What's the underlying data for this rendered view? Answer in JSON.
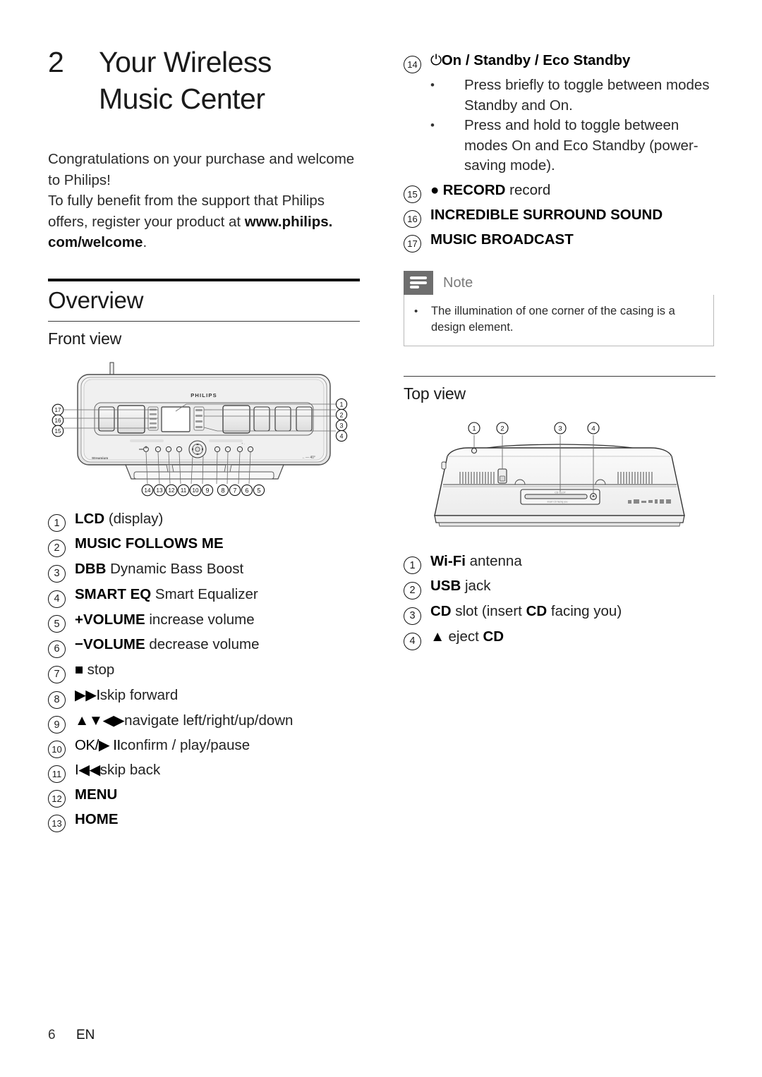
{
  "chapter": {
    "number": "2",
    "title_line1": "Your Wireless",
    "title_line2": "Music Center"
  },
  "intro": {
    "line1": "Congratulations on your purchase and welcome",
    "line2": "to Philips!",
    "line3": "To fully benefit from the support that Philips",
    "line4_pre": "offers, register your product at ",
    "line4_bold": "www.philips.",
    "line5_bold": "com/welcome",
    "line5_post": "."
  },
  "sections": {
    "overview": "Overview",
    "front_view": "Front view",
    "top_view": "Top view"
  },
  "front_legend": [
    {
      "num": "1",
      "glyph": "",
      "bold": "LCD",
      "rest": " (display)"
    },
    {
      "num": "2",
      "glyph": "",
      "bold": "MUSIC FOLLOWS ME",
      "rest": ""
    },
    {
      "num": "3",
      "glyph": "",
      "bold": "DBB",
      "rest": " Dynamic Bass Boost"
    },
    {
      "num": "4",
      "glyph": "",
      "bold": "SMART EQ",
      "rest": " Smart Equalizer"
    },
    {
      "num": "5",
      "glyph": "",
      "bold": "+VOLUME",
      "rest": " increase volume"
    },
    {
      "num": "6",
      "glyph": "",
      "bold": "−VOLUME",
      "rest": " decrease volume"
    },
    {
      "num": "7",
      "glyph": "■",
      "bold": "",
      "rest": " stop"
    },
    {
      "num": "8",
      "glyph": "▶▶I",
      "bold": "",
      "rest": "skip forward"
    },
    {
      "num": "9",
      "glyph": "▲▼◀▶",
      "bold": "",
      "rest": "navigate left/right/up/down"
    },
    {
      "num": "10",
      "glyph": "OK/▶ II",
      "bold": "",
      "rest": "confirm / play/pause"
    },
    {
      "num": "11",
      "glyph": "I◀◀",
      "bold": "",
      "rest": "skip back"
    },
    {
      "num": "12",
      "glyph": "",
      "bold": "MENU",
      "rest": ""
    },
    {
      "num": "13",
      "glyph": "",
      "bold": "HOME",
      "rest": ""
    }
  ],
  "right_legend": [
    {
      "num": "14",
      "glyph": "⏻",
      "bold": "On / Standby / Eco Standby",
      "rest": "",
      "sub": [
        "Press briefly to toggle between modes Standby and On.",
        "Press and hold to toggle between modes On and Eco Standby (power-saving mode)."
      ]
    },
    {
      "num": "15",
      "glyph": "●",
      "bold": " RECORD",
      "rest": " record",
      "sub": []
    },
    {
      "num": "16",
      "glyph": "",
      "bold": "INCREDIBLE SURROUND SOUND",
      "rest": "",
      "sub": []
    },
    {
      "num": "17",
      "glyph": "",
      "bold": "MUSIC BROADCAST",
      "rest": "",
      "sub": []
    }
  ],
  "note": {
    "label": "Note",
    "bullet": "•",
    "text": "The illumination of one corner of the casing is a design element."
  },
  "top_legend": [
    {
      "num": "1",
      "glyph": "",
      "bold": "Wi-Fi",
      "rest": " antenna"
    },
    {
      "num": "2",
      "glyph": "",
      "bold": "USB",
      "rest": " jack"
    },
    {
      "num": "3",
      "glyph": "",
      "bold": "CD",
      "rest": " slot (insert <b>CD</b> facing you)"
    },
    {
      "num": "4",
      "glyph": "▲",
      "bold": "",
      "rest": " eject <b>CD</b>"
    }
  ],
  "figures": {
    "front": {
      "brand": "PHILIPS",
      "callouts_right": [
        "1",
        "2",
        "3",
        "4"
      ],
      "callouts_left": [
        "17",
        "16",
        "15"
      ],
      "callouts_bottom": [
        "14",
        "13",
        "12",
        "11",
        "10",
        "9",
        "8",
        "7",
        "6",
        "5"
      ]
    },
    "top": {
      "callouts": [
        "1",
        "2",
        "3",
        "4"
      ]
    }
  },
  "footer": {
    "page": "6",
    "lang": "EN"
  },
  "colors": {
    "text": "#1a1a1a",
    "rule": "#000000",
    "note_tab": "#6e6e6e",
    "note_border": "#b9b9b9",
    "note_label": "#7b7b7b"
  }
}
